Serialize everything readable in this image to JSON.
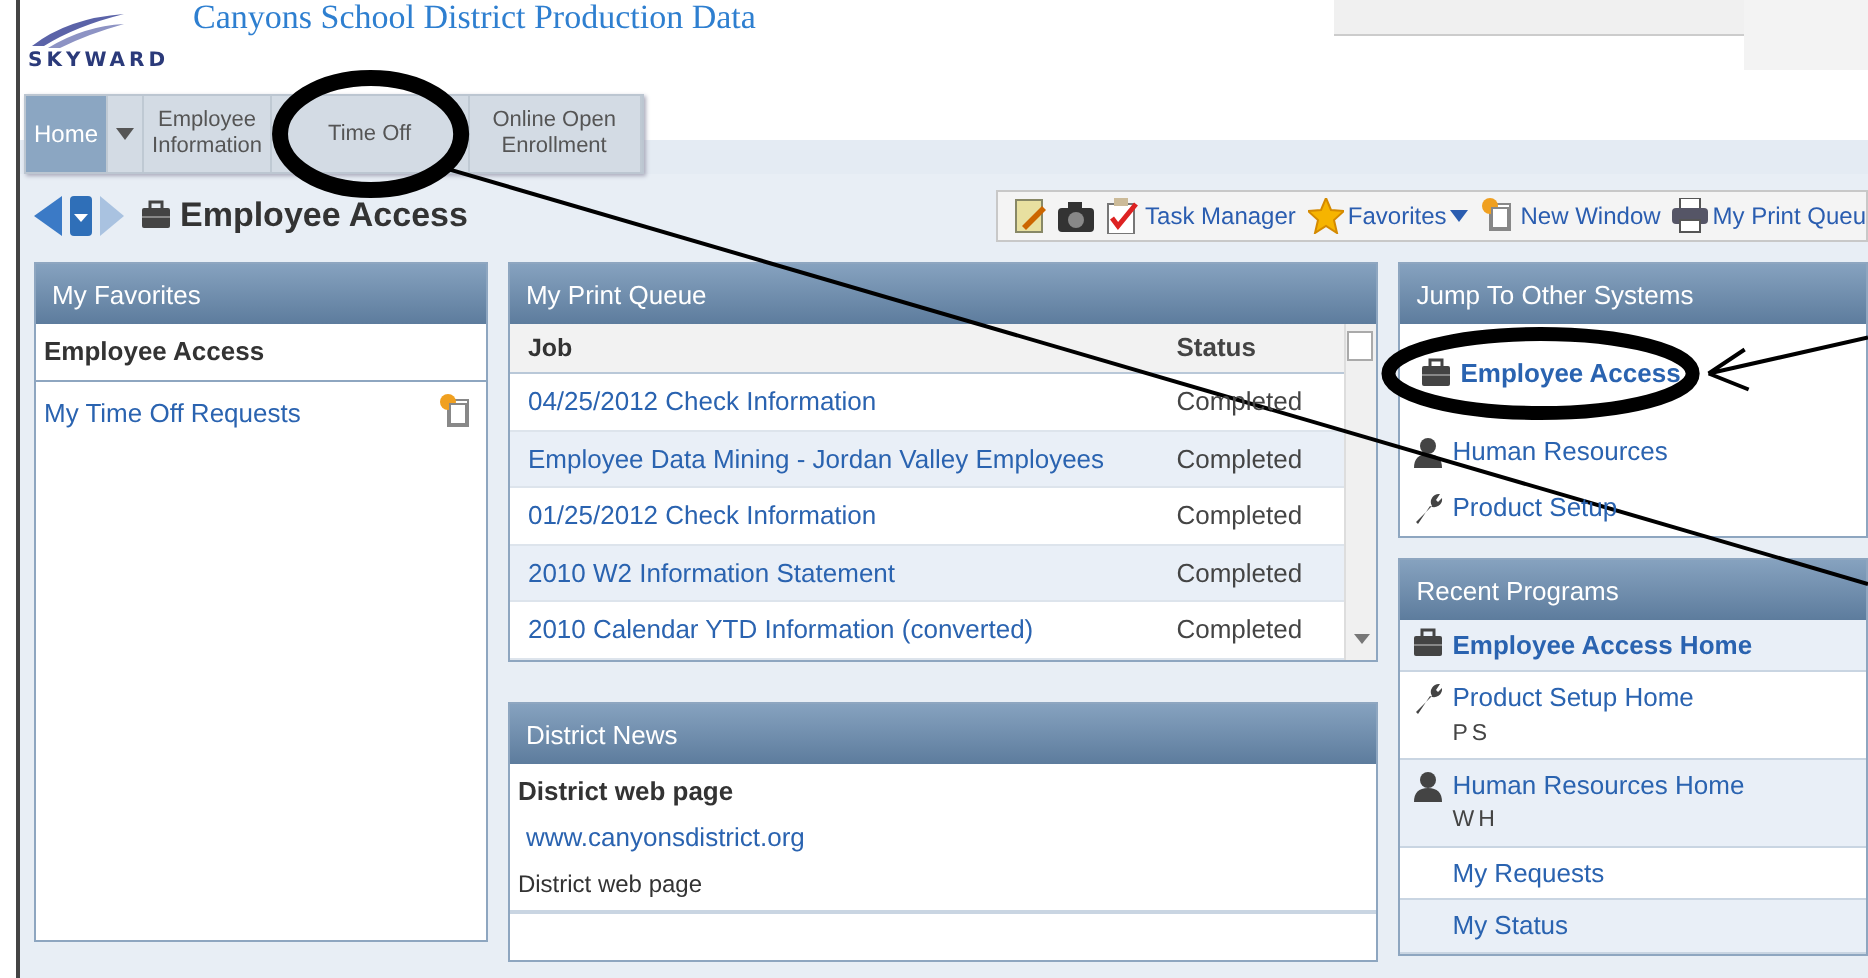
{
  "header": {
    "title": "Canyons School District Production Data",
    "logo": "SKYWARD"
  },
  "nav": [
    {
      "label": "Home",
      "selected": true,
      "menu": true
    },
    {
      "label": "Employee Information",
      "selected": false,
      "menu": false
    },
    {
      "label": "Time Off",
      "selected": false,
      "menu": false
    },
    {
      "label": "Online Open Enrollment",
      "selected": false,
      "menu": false
    }
  ],
  "page_title": "Employee Access",
  "toolbar": [
    {
      "label": "Task Manager",
      "dropdown": false
    },
    {
      "label": "Favorites",
      "dropdown": true
    },
    {
      "label": "New Window",
      "dropdown": false
    },
    {
      "label": "My Print Queu",
      "dropdown": false
    }
  ],
  "favorites": {
    "title": "My Favorites",
    "section": "Employee Access",
    "items": [
      {
        "label": "My Time Off Requests"
      }
    ]
  },
  "print_queue": {
    "title": "My Print Queue",
    "columns": [
      "Job",
      "Status"
    ],
    "rows": [
      {
        "job": "04/25/2012 Check Information",
        "status": "Completed"
      },
      {
        "job": "Employee Data Mining - Jordan Valley Employees",
        "status": "Completed"
      },
      {
        "job": "01/25/2012 Check Information",
        "status": "Completed"
      },
      {
        "job": "2010 W2 Information Statement",
        "status": "Completed"
      },
      {
        "job": "2010 Calendar YTD Information (converted)",
        "status": "Completed"
      }
    ]
  },
  "news": {
    "title": "District News",
    "items": [
      {
        "heading": "District web page",
        "link": "www.canyonsdistrict.org",
        "description": "District web page"
      }
    ]
  },
  "jump": {
    "title": "Jump To Other Systems",
    "items": [
      {
        "label": "Employee Access",
        "kind": "employee",
        "current": true
      },
      {
        "label": "Human Resources",
        "kind": "hr",
        "current": false
      },
      {
        "label": "Product Setup",
        "kind": "setup",
        "current": false
      }
    ]
  },
  "recent": {
    "title": "Recent Programs",
    "items": [
      {
        "label": "Employee Access Home",
        "kind": "employee",
        "current": true
      },
      {
        "label": "Product Setup Home",
        "kind": "setup",
        "current": false,
        "code": "PS"
      },
      {
        "label": "Human Resources Home",
        "kind": "hr",
        "current": false,
        "code": "WH"
      },
      {
        "label": "My Requests",
        "kind": "plain",
        "current": false
      },
      {
        "label": "My Status",
        "kind": "plain",
        "current": false
      }
    ]
  }
}
